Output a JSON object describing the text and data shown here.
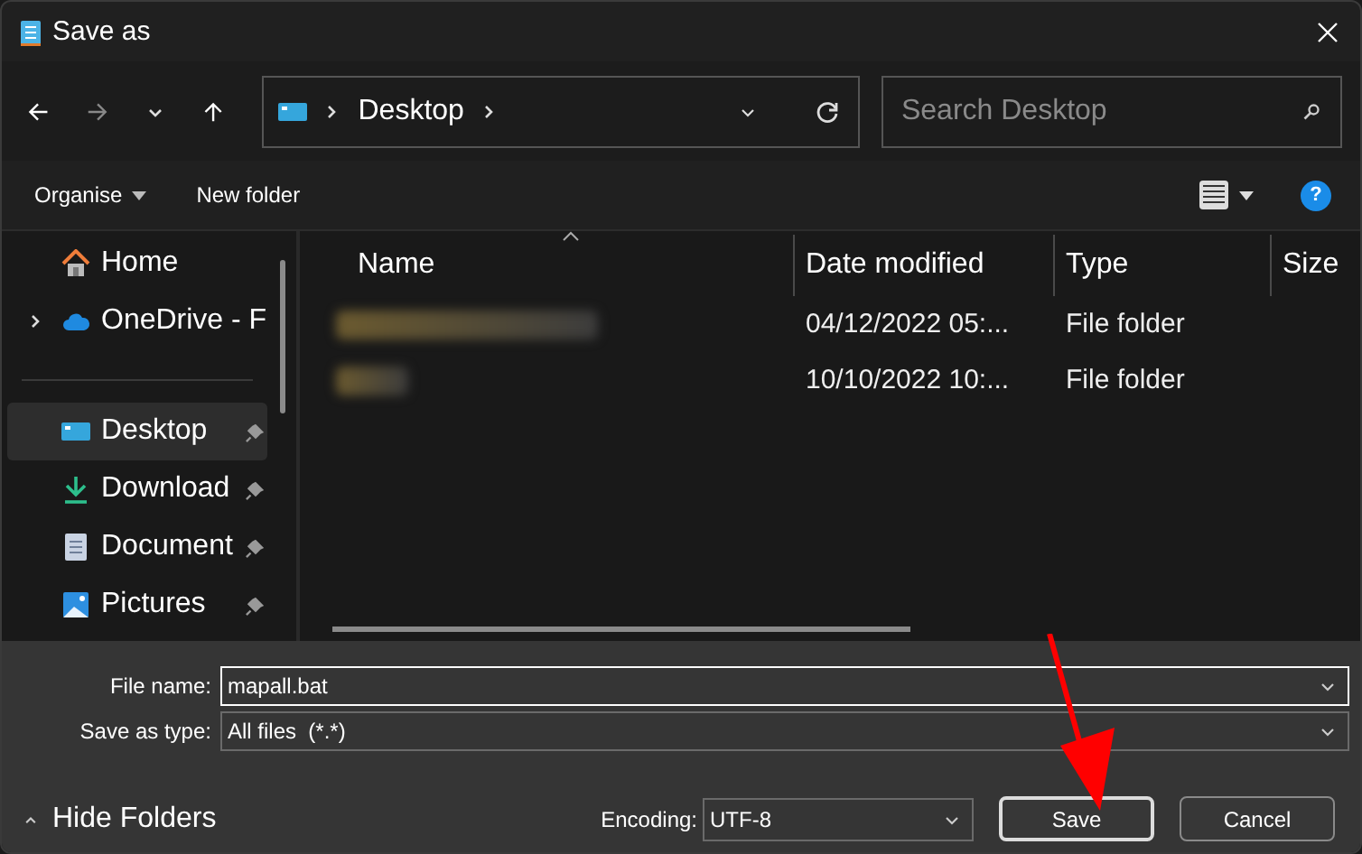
{
  "window": {
    "title": "Save as"
  },
  "nav": {
    "breadcrumb": "Desktop",
    "search": {
      "placeholder": "Search Desktop"
    }
  },
  "toolbar": {
    "organise": "Organise",
    "new_folder": "New folder",
    "help": "?"
  },
  "sidebar": {
    "groups": [
      [
        {
          "label": "Home",
          "kind": "home",
          "expandable": false,
          "selected": false,
          "pinned": false
        },
        {
          "label": "OneDrive - F",
          "kind": "cloud",
          "expandable": true,
          "selected": false,
          "pinned": false
        }
      ],
      [
        {
          "label": "Desktop",
          "kind": "desktop",
          "expandable": false,
          "selected": true,
          "pinned": true
        },
        {
          "label": "Download",
          "kind": "download",
          "expandable": false,
          "selected": false,
          "pinned": true
        },
        {
          "label": "Document",
          "kind": "document",
          "expandable": false,
          "selected": false,
          "pinned": true
        },
        {
          "label": "Pictures",
          "kind": "pictures",
          "expandable": false,
          "selected": false,
          "pinned": true
        }
      ]
    ]
  },
  "table": {
    "columns": [
      "Name",
      "Date modified",
      "Type",
      "Size"
    ],
    "rows": [
      {
        "date_modified": "04/12/2022 05:...",
        "type": "File folder"
      },
      {
        "date_modified": "10/10/2022 10:...",
        "type": "File folder"
      }
    ]
  },
  "form": {
    "file_name": {
      "label": "File name:",
      "value": "mapall.bat"
    },
    "save_as_type": {
      "label": "Save as type:",
      "value": "All files  (*.*)"
    },
    "encoding": {
      "label": "Encoding:",
      "value": "UTF-8"
    }
  },
  "footer": {
    "hide_folders": "Hide Folders",
    "buttons": [
      {
        "label": "Save",
        "default": true
      },
      {
        "label": "Cancel",
        "default": false
      }
    ]
  }
}
